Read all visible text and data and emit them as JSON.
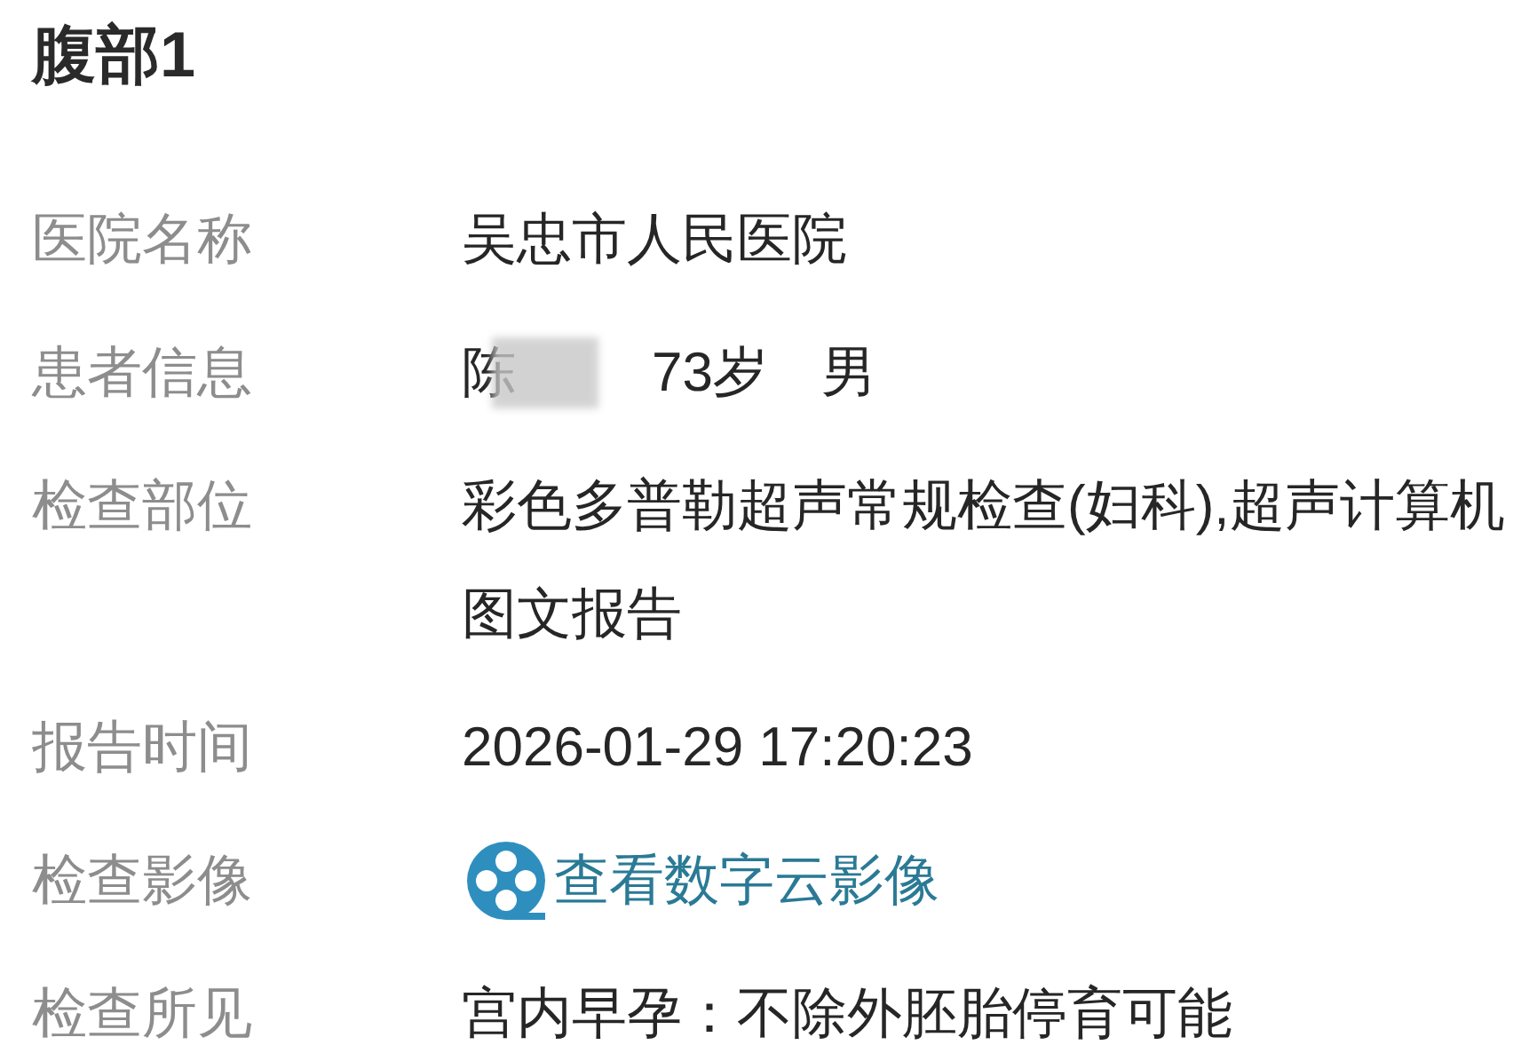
{
  "title": "腹部1",
  "fields": [
    {
      "label": "医院名称",
      "kind": "text",
      "value": "吴忠市人民医院"
    },
    {
      "label": "患者信息",
      "kind": "patient",
      "name": "陈",
      "age": "73岁",
      "sex": "男"
    },
    {
      "label": "检查部位",
      "kind": "text",
      "value": "彩色多普勒超声常规检查(妇科),超声计算机图文报告"
    },
    {
      "label": "报告时间",
      "kind": "text",
      "value": "2026-01-29 17:20:23"
    },
    {
      "label": "检查影像",
      "kind": "link",
      "value": "查看数字云影像"
    },
    {
      "label": "检查所见",
      "kind": "text",
      "value": "宫内早孕：不除外胚胎停育可能"
    }
  ]
}
